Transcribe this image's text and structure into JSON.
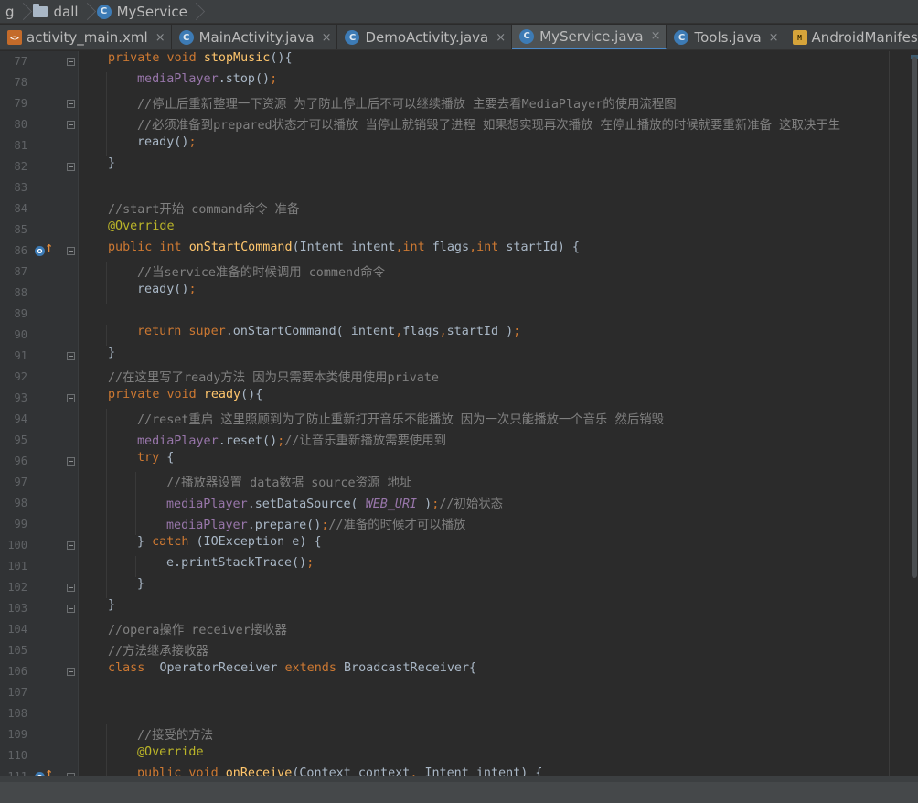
{
  "breadcrumb": {
    "items": [
      {
        "label": "g",
        "icon": "none"
      },
      {
        "label": "dall",
        "icon": "folder-icon"
      },
      {
        "label": "MyService",
        "icon": "class-icon"
      }
    ]
  },
  "tabs": [
    {
      "label": "activity_main.xml",
      "icon": "xml-file-icon",
      "closable": true,
      "active": false
    },
    {
      "label": "MainActivity.java",
      "icon": "class-icon",
      "closable": true,
      "active": false
    },
    {
      "label": "DemoActivity.java",
      "icon": "class-icon",
      "closable": true,
      "active": false
    },
    {
      "label": "MyService.java",
      "icon": "class-icon",
      "closable": true,
      "active": true
    },
    {
      "label": "Tools.java",
      "icon": "class-icon",
      "closable": true,
      "active": false
    },
    {
      "label": "AndroidManifes",
      "icon": "manifest-file-icon",
      "closable": false,
      "active": false
    }
  ],
  "icon_glyphs": {
    "class": "C",
    "close": "×",
    "xml": "<>",
    "manifest": "M",
    "override": "O",
    "override_arrow": "↑"
  },
  "editor": {
    "lines": [
      {
        "n": "77",
        "indent": 1,
        "fold": true,
        "segs": [
          [
            "kw",
            "private void "
          ],
          [
            "fn",
            "stopMusic"
          ],
          [
            "",
            "(){"
          ]
        ]
      },
      {
        "n": "78",
        "indent": 2,
        "segs": [
          [
            "fld",
            "mediaPlayer"
          ],
          [
            "",
            ".stop()"
          ],
          [
            "pn",
            ";"
          ]
        ]
      },
      {
        "n": "79",
        "indent": 2,
        "fold": true,
        "segs": [
          [
            "cm",
            "//停止后重新整理一下资源 为了防止停止后不可以继续播放 主要去看MediaPlayer的使用流程图"
          ]
        ]
      },
      {
        "n": "80",
        "indent": 2,
        "fold": true,
        "segs": [
          [
            "cm",
            "//必须准备到prepared状态才可以播放 当停止就销毁了进程 如果想实现再次播放 在停止播放的时候就要重新准备 这取决于生"
          ]
        ]
      },
      {
        "n": "81",
        "indent": 2,
        "segs": [
          [
            "",
            "ready()"
          ],
          [
            "pn",
            ";"
          ]
        ]
      },
      {
        "n": "82",
        "indent": 1,
        "fold": true,
        "segs": [
          [
            "",
            "}"
          ]
        ]
      },
      {
        "n": "83",
        "indent": 0,
        "segs": []
      },
      {
        "n": "84",
        "indent": 1,
        "segs": [
          [
            "cm",
            "//start开始 command命令 准备"
          ]
        ]
      },
      {
        "n": "85",
        "indent": 1,
        "segs": [
          [
            "an",
            "@Override"
          ]
        ]
      },
      {
        "n": "86",
        "indent": 1,
        "fold": true,
        "mark": "override",
        "segs": [
          [
            "kw",
            "public int "
          ],
          [
            "fn",
            "onStartCommand"
          ],
          [
            "",
            "(Intent intent"
          ],
          [
            "pn",
            ","
          ],
          [
            "kw",
            "int "
          ],
          [
            "",
            "flags"
          ],
          [
            "pn",
            ","
          ],
          [
            "kw",
            "int "
          ],
          [
            "",
            "startId) {"
          ]
        ]
      },
      {
        "n": "87",
        "indent": 2,
        "segs": [
          [
            "cm",
            "//当service准备的时候调用 commend命令"
          ]
        ]
      },
      {
        "n": "88",
        "indent": 2,
        "segs": [
          [
            "",
            "ready()"
          ],
          [
            "pn",
            ";"
          ]
        ]
      },
      {
        "n": "89",
        "indent": 0,
        "segs": []
      },
      {
        "n": "90",
        "indent": 2,
        "segs": [
          [
            "kw",
            "return super"
          ],
          [
            "",
            ".onStartCommand( intent"
          ],
          [
            "pn",
            ","
          ],
          [
            "",
            "flags"
          ],
          [
            "pn",
            ","
          ],
          [
            "",
            "startId )"
          ],
          [
            "pn",
            ";"
          ]
        ]
      },
      {
        "n": "91",
        "indent": 1,
        "fold": true,
        "segs": [
          [
            "",
            "}"
          ]
        ]
      },
      {
        "n": "92",
        "indent": 1,
        "segs": [
          [
            "cm",
            "//在这里写了ready方法 因为只需要本类使用使用private"
          ]
        ]
      },
      {
        "n": "93",
        "indent": 1,
        "fold": true,
        "segs": [
          [
            "kw",
            "private void "
          ],
          [
            "fn",
            "ready"
          ],
          [
            "",
            "(){"
          ]
        ]
      },
      {
        "n": "94",
        "indent": 2,
        "segs": [
          [
            "cm",
            "//reset重启 这里照顾到为了防止重新打开音乐不能播放 因为一次只能播放一个音乐 然后销毁"
          ]
        ]
      },
      {
        "n": "95",
        "indent": 2,
        "segs": [
          [
            "fld",
            "mediaPlayer"
          ],
          [
            "",
            ".reset()"
          ],
          [
            "pn",
            ";"
          ],
          [
            "cm",
            "//让音乐重新播放需要使用到"
          ]
        ]
      },
      {
        "n": "96",
        "indent": 2,
        "fold": true,
        "segs": [
          [
            "kw",
            "try "
          ],
          [
            "",
            "{"
          ]
        ]
      },
      {
        "n": "97",
        "indent": 3,
        "segs": [
          [
            "cm",
            "//播放器设置 data数据 source资源 地址"
          ]
        ]
      },
      {
        "n": "98",
        "indent": 3,
        "segs": [
          [
            "fld",
            "mediaPlayer"
          ],
          [
            "",
            ".setDataSource( "
          ],
          [
            "cst",
            "WEB_URI"
          ],
          [
            "",
            " )"
          ],
          [
            "pn",
            ";"
          ],
          [
            "cm",
            "//初始状态"
          ]
        ]
      },
      {
        "n": "99",
        "indent": 3,
        "segs": [
          [
            "fld",
            "mediaPlayer"
          ],
          [
            "",
            ".prepare()"
          ],
          [
            "pn",
            ";"
          ],
          [
            "cm",
            "//准备的时候才可以播放"
          ]
        ]
      },
      {
        "n": "100",
        "indent": 2,
        "fold": true,
        "segs": [
          [
            "",
            "} "
          ],
          [
            "kw",
            "catch "
          ],
          [
            "",
            "(IOException e) {"
          ]
        ]
      },
      {
        "n": "101",
        "indent": 3,
        "segs": [
          [
            "",
            "e.printStackTrace()"
          ],
          [
            "pn",
            ";"
          ]
        ]
      },
      {
        "n": "102",
        "indent": 2,
        "fold": true,
        "segs": [
          [
            "",
            "}"
          ]
        ]
      },
      {
        "n": "103",
        "indent": 1,
        "fold": true,
        "segs": [
          [
            "",
            "}"
          ]
        ]
      },
      {
        "n": "104",
        "indent": 1,
        "segs": [
          [
            "cm",
            "//opera操作 receiver接收器"
          ]
        ]
      },
      {
        "n": "105",
        "indent": 1,
        "segs": [
          [
            "cm",
            "//方法继承接收器"
          ]
        ]
      },
      {
        "n": "106",
        "indent": 1,
        "fold": true,
        "segs": [
          [
            "kw",
            "class  "
          ],
          [
            "",
            "OperatorReceiver "
          ],
          [
            "kw",
            "extends "
          ],
          [
            "",
            "BroadcastReceiver{"
          ]
        ]
      },
      {
        "n": "107",
        "indent": 0,
        "segs": []
      },
      {
        "n": "108",
        "indent": 0,
        "segs": []
      },
      {
        "n": "109",
        "indent": 2,
        "segs": [
          [
            "cm",
            "//接受的方法"
          ]
        ]
      },
      {
        "n": "110",
        "indent": 2,
        "segs": [
          [
            "an",
            "@Override"
          ]
        ]
      },
      {
        "n": "111",
        "indent": 2,
        "fold": true,
        "mark": "override",
        "segs": [
          [
            "kw",
            "public void "
          ],
          [
            "fn",
            "onReceive"
          ],
          [
            "",
            "(Context context"
          ],
          [
            "pn",
            ", "
          ],
          [
            "",
            "Intent intent) {"
          ]
        ]
      }
    ]
  },
  "colors": {
    "background": "#2b2b2b",
    "keyword": "#cc7832",
    "method": "#ffc66d",
    "comment": "#808080",
    "annotation": "#bbb529",
    "field": "#9876aa",
    "text": "#a9b7c6",
    "active_tab_accent": "#4a88c7"
  }
}
